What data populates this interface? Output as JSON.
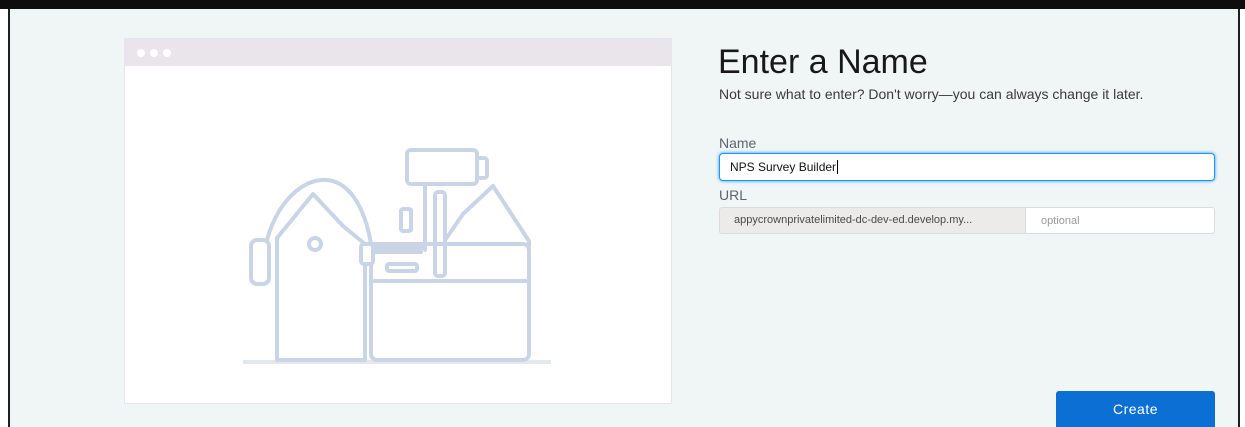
{
  "header": {
    "title": "Enter a Name",
    "subtitle": "Not sure what to enter? Don't worry—you can always change it later."
  },
  "form": {
    "name_label": "Name",
    "name_value": "NPS Survey Builder",
    "url_label": "URL",
    "url_prefix": "appycrownprivatelimited-dc-dev-ed.develop.my...",
    "url_placeholder": "optional",
    "create_label": "Create"
  },
  "illustration": {
    "icon": "toolbox-icon",
    "line_color": "#c9d5e6",
    "fill_color": "#ffffff"
  },
  "colors": {
    "accent": "#0b6fd4",
    "focus_ring": "#1b96ff",
    "background": "#f0f5f6",
    "card_bar": "#e9e5ea"
  }
}
